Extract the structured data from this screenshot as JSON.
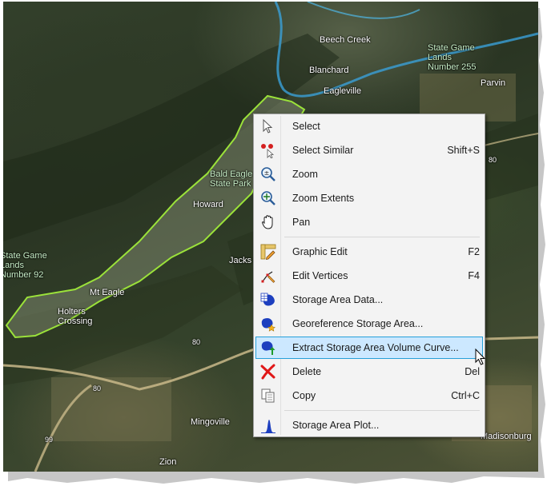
{
  "map": {
    "labels": {
      "beech_creek": "Beech Creek",
      "blanchard": "Blanchard",
      "eagleville": "Eagleville",
      "state_game_lands_255": "State Game\nLands\nNumber 255",
      "parvin": "Parvin",
      "bald_eagle_state_park": "Bald Eagle\nState Park",
      "howard": "Howard",
      "jacksonville": "Jacks",
      "state_game_lands_92": "State Game\nLands\nNumber 92",
      "mt_eagle": "Mt Eagle",
      "holters_crossing": "Holters\nCrossing",
      "mingoville": "Mingoville",
      "zion": "Zion",
      "madisonburg": "Madisonburg",
      "route_80_a": "80",
      "route_80_b": "80",
      "route_80_c": "80",
      "route_99": "99"
    },
    "colors": {
      "storage_area_outline": "#9be23a",
      "river": "#3aa0d8"
    }
  },
  "context_menu": {
    "items": {
      "select": {
        "label": "Select",
        "shortcut": "",
        "icon": "arrow-cursor-icon"
      },
      "select_similar": {
        "label": "Select Similar",
        "shortcut": "Shift+S",
        "icon": "red-dots-cursor-icon"
      },
      "zoom": {
        "label": "Zoom",
        "shortcut": "",
        "icon": "magnifier-plus-minus-icon"
      },
      "zoom_extents": {
        "label": "Zoom Extents",
        "shortcut": "",
        "icon": "magnifier-arrows-icon"
      },
      "pan": {
        "label": "Pan",
        "shortcut": "",
        "icon": "hand-icon"
      },
      "graphic_edit": {
        "label": "Graphic Edit",
        "shortcut": "F2",
        "icon": "pencil-ruler-icon"
      },
      "edit_vertices": {
        "label": "Edit Vertices",
        "shortcut": "F4",
        "icon": "vertices-icon"
      },
      "storage_area_data": {
        "label": "Storage Area Data...",
        "shortcut": "",
        "icon": "table-blob-icon"
      },
      "georeference_storage_area": {
        "label": "Georeference Storage Area...",
        "shortcut": "",
        "icon": "blob-star-icon"
      },
      "extract_volume_curve": {
        "label": "Extract Storage Area Volume Curve...",
        "shortcut": "",
        "icon": "blob-arrow-icon"
      },
      "delete": {
        "label": "Delete",
        "shortcut": "Del",
        "icon": "red-x-icon"
      },
      "copy": {
        "label": "Copy",
        "shortcut": "Ctrl+C",
        "icon": "copy-pages-icon"
      },
      "storage_area_plot": {
        "label": "Storage Area Plot...",
        "shortcut": "",
        "icon": "bell-plot-icon"
      }
    },
    "highlighted": "Extract Storage Area Volume Curve...",
    "colors": {
      "highlight_bg": "#cce8ff",
      "highlight_border": "#26a0da",
      "menu_bg": "#f3f3f3"
    }
  }
}
